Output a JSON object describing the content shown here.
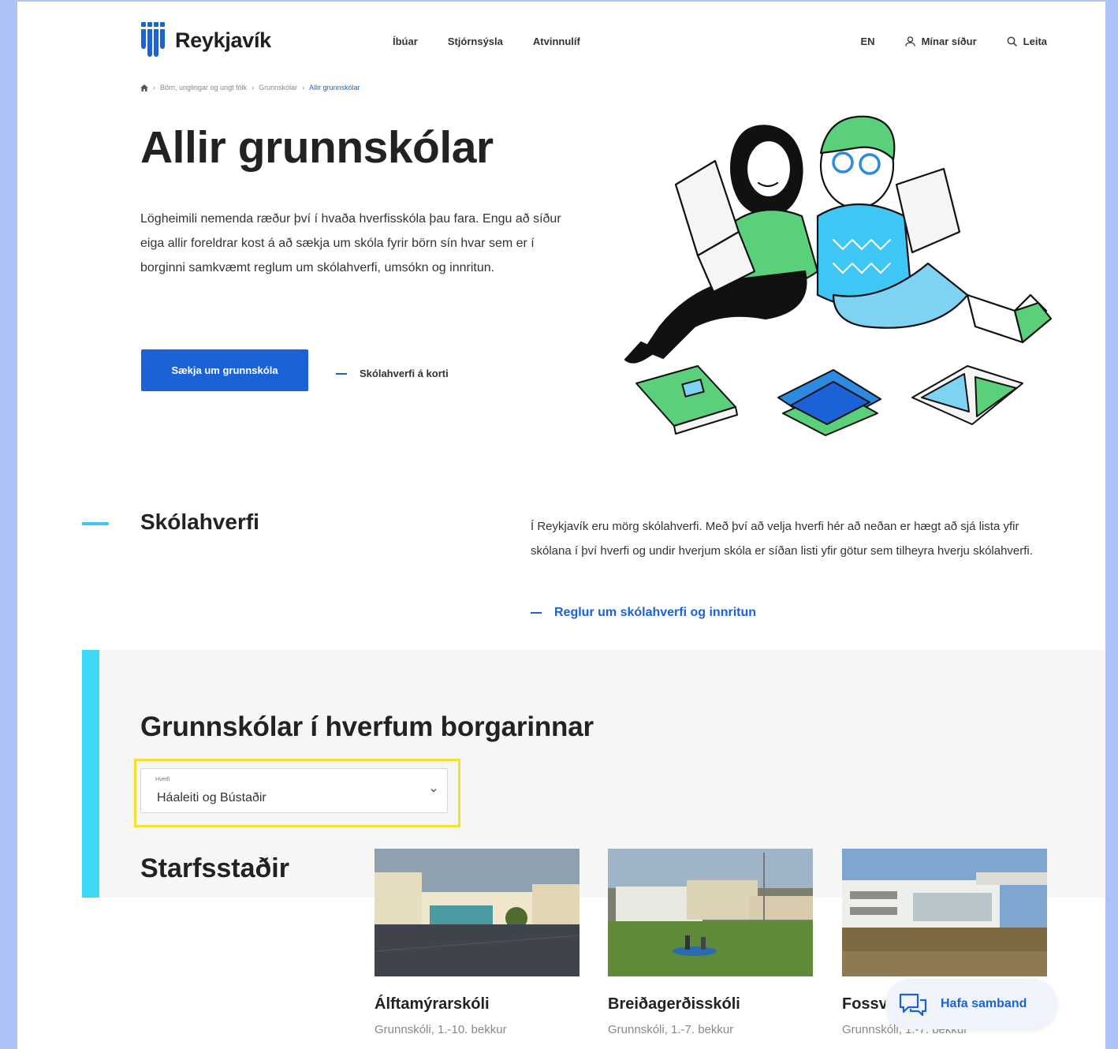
{
  "header": {
    "logo_text": "Reykjavík",
    "nav": [
      "Íbúar",
      "Stjórnsýsla",
      "Atvinnulíf"
    ],
    "lang": "EN",
    "my_pages": "Mínar síður",
    "search": "Leita"
  },
  "breadcrumb": {
    "items": [
      "Börn, unglingar og ungt fólk",
      "Grunnskólar"
    ],
    "current": "Allir grunnskólar"
  },
  "hero": {
    "title": "Allir grunnskólar",
    "text": "Lögheimili nemenda ræður því í hvaða hverfisskóla þau fara. Engu að síður eiga allir foreldrar kost á að sækja um skóla fyrir börn sín hvar sem er í borginni samkvæmt reglum um skólahverfi, umsókn og innritun.",
    "primary_button": "Sækja um grunnskóla",
    "map_link": "Skólahverfi á korti"
  },
  "district_section": {
    "title": "Skólahverfi",
    "text": "Í Reykjavík eru mörg skólahverfi. Með því að velja hverfi hér að neðan er hægt að sjá lista yfir skólana í því hverfi og undir hverjum skóla er síðan listi yfir götur sem tilheyra hverju skólahverfi.",
    "link": "Reglur um skólahverfi og innritun"
  },
  "schools_panel": {
    "title": "Grunnskólar í hverfum borgarinnar",
    "select_label": "Hverfi",
    "select_value": "Háaleiti og Bústaðir",
    "workplaces_title": "Starfsstaðir"
  },
  "cards": [
    {
      "name": "Álftamýrarskóli",
      "meta": "Grunnskóli,  1.-10. bekkur"
    },
    {
      "name": "Breiðagerðisskóli",
      "meta": "Grunnskóli,  1.-7. bekkur"
    },
    {
      "name": "Fossv",
      "meta": "Grunnskóli, 1.-7. bekkur"
    }
  ],
  "contact": {
    "label": "Hafa samband"
  },
  "colors": {
    "accent_blue": "#1a62d6",
    "accent_cyan": "#3ed8f7",
    "highlight": "#f4e22a"
  }
}
